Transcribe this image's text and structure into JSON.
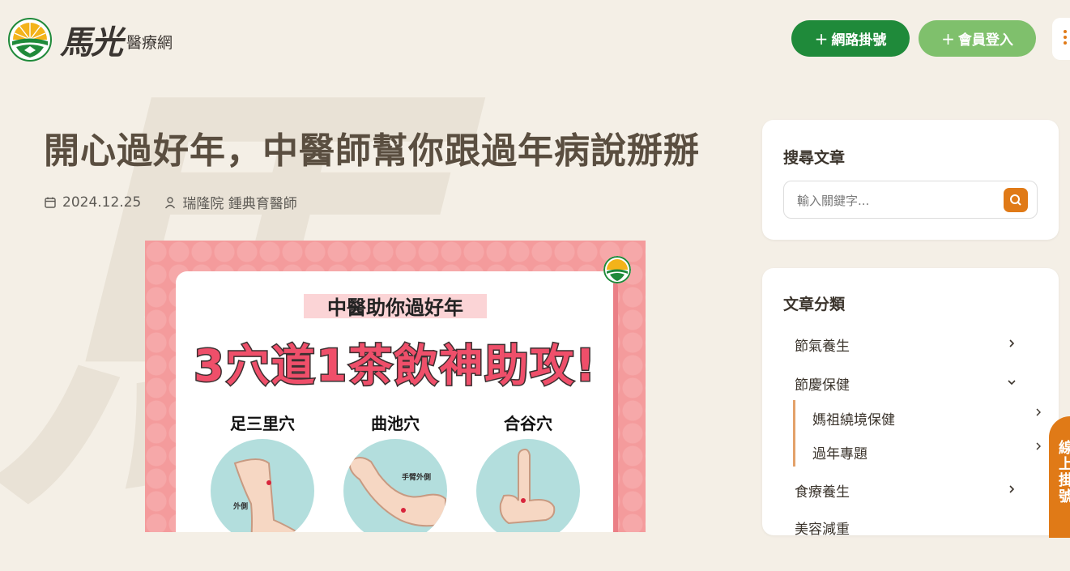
{
  "brand": {
    "logo_script": "馬光",
    "logo_sub": "醫療網"
  },
  "header": {
    "register_label": "網路掛號",
    "login_label": "會員登入",
    "plus_icon": "+",
    "accent": "#1f8a3a",
    "accent_light": "#7fc06c",
    "orange": "#e07a17"
  },
  "watermark": "馬",
  "article": {
    "title": "開心過好年，中醫師幫你跟過年病說掰掰",
    "date": "2024.12.25",
    "author": "瑞隆院 鍾典育醫師",
    "poster": {
      "subtitle": "中醫助你過好年",
      "headline": "3穴道1茶飲神助攻!",
      "points": [
        {
          "name": "足三里穴",
          "tag": "外側"
        },
        {
          "name": "曲池穴",
          "tag": "手臂外側"
        },
        {
          "name": "合谷穴",
          "tag": ""
        }
      ]
    }
  },
  "sidebar": {
    "search": {
      "title": "搜尋文章",
      "placeholder": "輸入關鍵字..."
    },
    "categories": {
      "title": "文章分類",
      "items": [
        {
          "label": "節氣養生"
        },
        {
          "label": "節慶保健"
        },
        {
          "label": "食療養生"
        },
        {
          "label": "美容減重"
        }
      ],
      "sub_items": [
        {
          "label": "媽祖繞境保健"
        },
        {
          "label": "過年專題"
        }
      ]
    }
  },
  "float_tab": {
    "label": "線上掛號"
  }
}
